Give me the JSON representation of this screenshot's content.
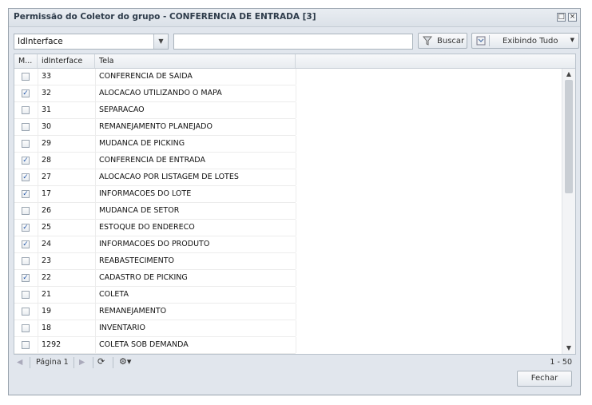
{
  "window": {
    "title": "Permissão do Coletor do grupo - CONFERENCIA DE ENTRADA [3]"
  },
  "toolbar": {
    "field_combo_value": "IdInterface",
    "search_value": "",
    "search_button_label": "Buscar",
    "filter_button_label": "Exibindo Tudo"
  },
  "grid": {
    "columns": [
      "M...",
      "idInterface",
      "Tela"
    ],
    "rows": [
      {
        "checked": false,
        "id": "33",
        "tela": "CONFERENCIA DE SAIDA"
      },
      {
        "checked": true,
        "id": "32",
        "tela": "ALOCACAO UTILIZANDO O MAPA"
      },
      {
        "checked": false,
        "id": "31",
        "tela": "SEPARACAO"
      },
      {
        "checked": false,
        "id": "30",
        "tela": "REMANEJAMENTO PLANEJADO"
      },
      {
        "checked": false,
        "id": "29",
        "tela": "MUDANCA DE PICKING"
      },
      {
        "checked": true,
        "id": "28",
        "tela": "CONFERENCIA DE ENTRADA"
      },
      {
        "checked": true,
        "id": "27",
        "tela": "ALOCACAO POR LISTAGEM DE LOTES"
      },
      {
        "checked": true,
        "id": "17",
        "tela": "INFORMACOES DO LOTE"
      },
      {
        "checked": false,
        "id": "26",
        "tela": "MUDANCA DE SETOR"
      },
      {
        "checked": true,
        "id": "25",
        "tela": "ESTOQUE DO ENDERECO"
      },
      {
        "checked": true,
        "id": "24",
        "tela": "INFORMACOES DO PRODUTO"
      },
      {
        "checked": false,
        "id": "23",
        "tela": "REABASTECIMENTO"
      },
      {
        "checked": true,
        "id": "22",
        "tela": "CADASTRO DE PICKING"
      },
      {
        "checked": false,
        "id": "21",
        "tela": "COLETA"
      },
      {
        "checked": false,
        "id": "19",
        "tela": "REMANEJAMENTO"
      },
      {
        "checked": false,
        "id": "18",
        "tela": "INVENTARIO"
      },
      {
        "checked": false,
        "id": "1292",
        "tela": "COLETA SOB DEMANDA"
      }
    ]
  },
  "pager": {
    "page_label": "Página 1",
    "range_label": "1 - 50"
  },
  "footer": {
    "close_label": "Fechar"
  },
  "icons": {
    "maximize": "maximize-icon",
    "close": "close-icon",
    "filter": "filter-icon",
    "list": "list-icon",
    "refresh": "refresh-icon",
    "settings": "gear-icon"
  }
}
